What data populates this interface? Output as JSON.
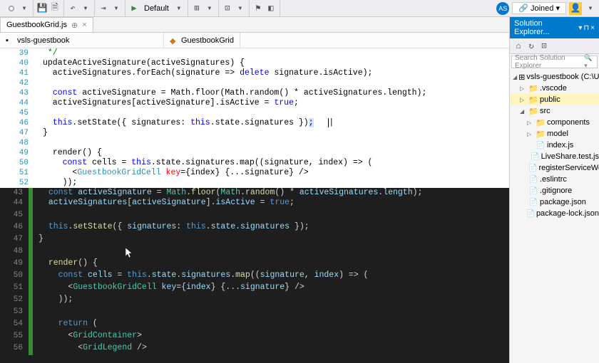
{
  "toolbar": {
    "config_label": "Default",
    "joined_label": "Joined",
    "avatar_initials": "AS"
  },
  "tab": {
    "filename": "GuestbookGrid.js"
  },
  "breadcrumb": {
    "item1": "vsls-guestbook",
    "item2": "GuestbookGrid"
  },
  "solution_explorer": {
    "title": "Solution Explorer...",
    "search_placeholder": "Search Solution Explorer",
    "search_shortcut": "⌘",
    "tree": {
      "root": "vsls-guestbook (C:\\User",
      "vscode": ".vscode",
      "public": "public",
      "src": "src",
      "components": "components",
      "model": "model",
      "index_js": "index.js",
      "liveshare_test": "LiveShare.test.js",
      "register_sw": "registerServiceWor",
      "eslintrc": ".eslintrc",
      "gitignore": ".gitignore",
      "package_json": "package.json",
      "package_lock": "package-lock.json"
    }
  },
  "light_code": {
    "lines": [
      39,
      40,
      41,
      42,
      43,
      44,
      45,
      46,
      47,
      48,
      49,
      50,
      51,
      52
    ]
  },
  "dark_code": {
    "lines": [
      43,
      44,
      45,
      46,
      47,
      48,
      49,
      50,
      51,
      52,
      53,
      54,
      55,
      56
    ]
  },
  "code_tokens": {
    "update_fn": "updateActiveSignature",
    "foreach": "forEach",
    "delete": "delete",
    "const": "const",
    "math": "Math",
    "floor": "floor",
    "random": "random",
    "true": "true",
    "this": "this",
    "setstate": "setState",
    "render": "render",
    "map": "map",
    "gridcell": "GuestbookGridCell",
    "key": "key",
    "return": "return",
    "gridcontainer": "GridContainer",
    "gridlegend": "GridLegend"
  }
}
